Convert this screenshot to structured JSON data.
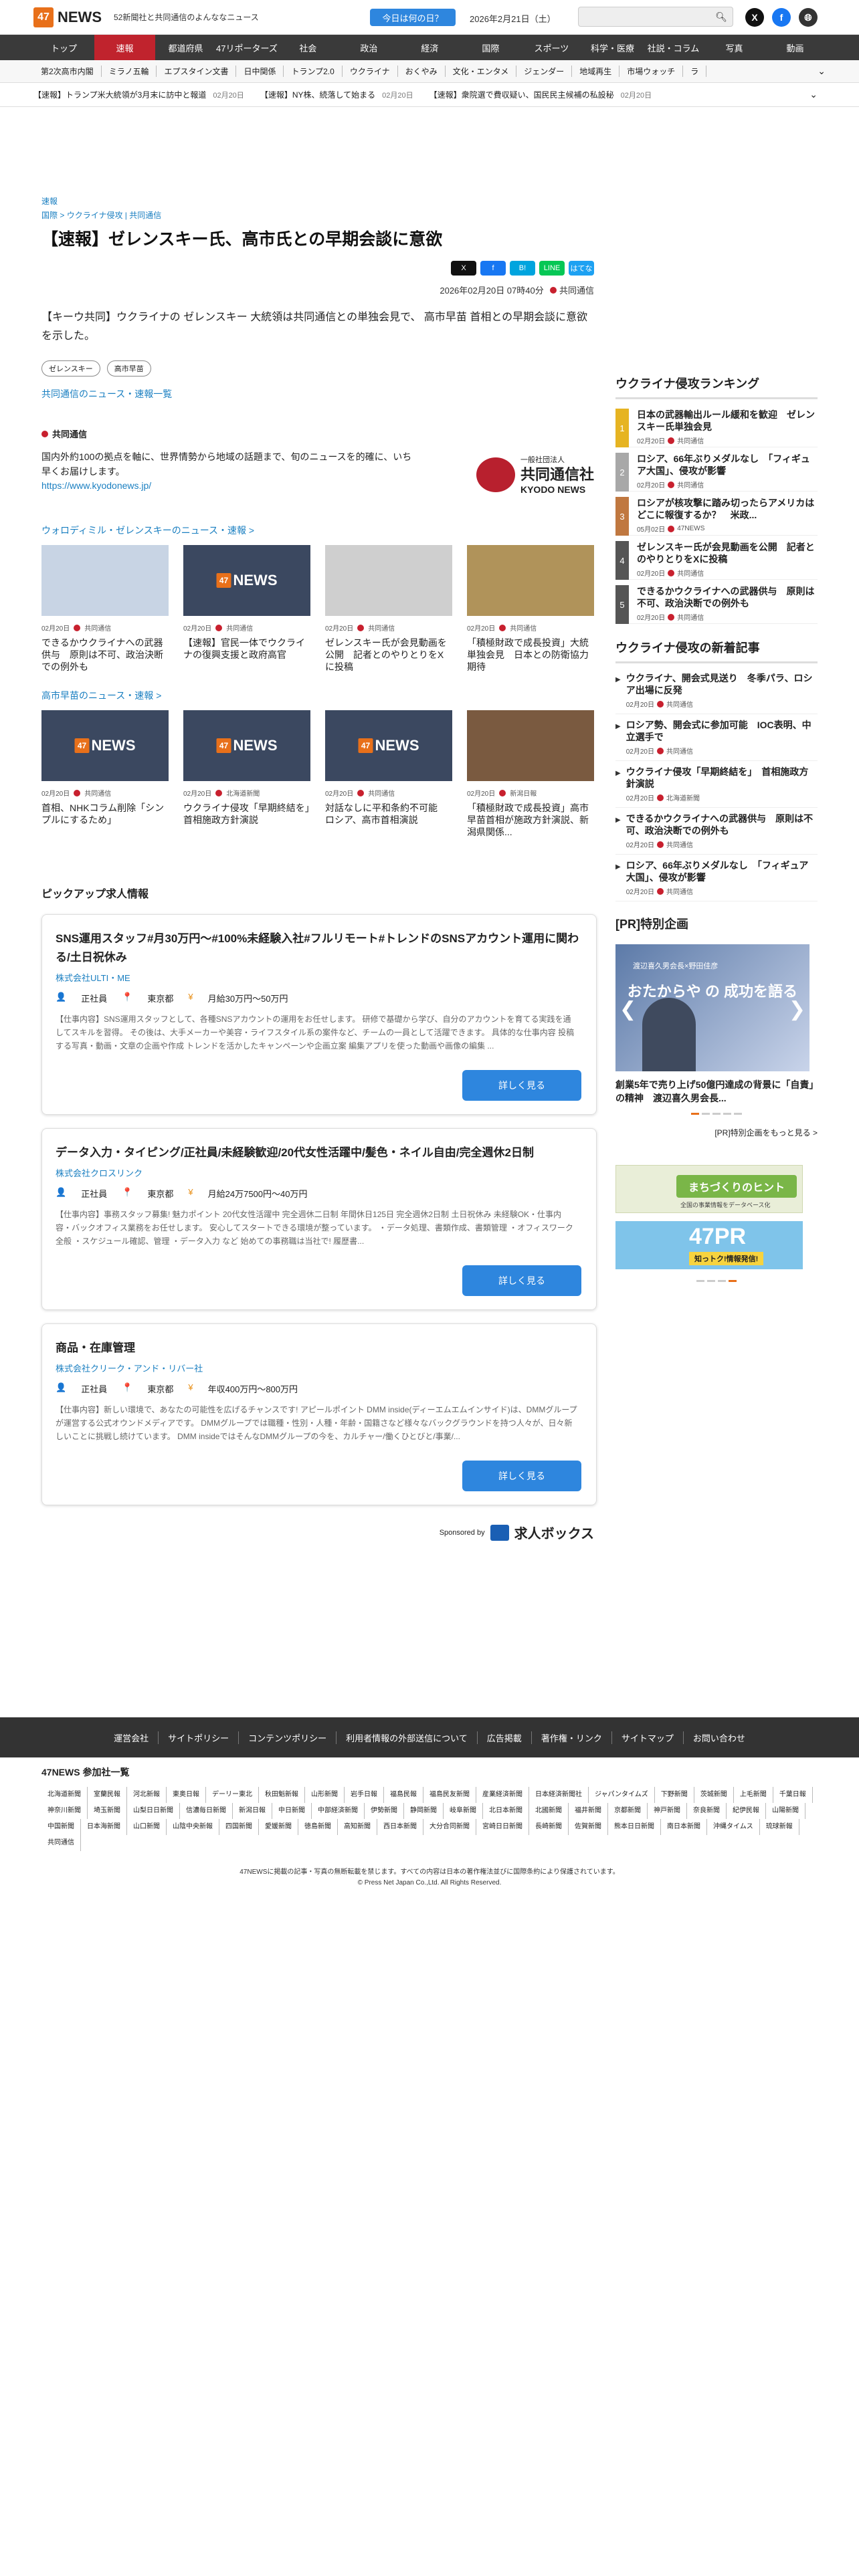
{
  "header": {
    "logo_text": "NEWS",
    "logo_badge": "47",
    "tagline": "52新聞社と共同通信のよんななニュース",
    "today_button": "今日は何の日？",
    "date": "2026年2月21日（土）"
  },
  "nav": [
    "トップ",
    "速報",
    "都道府県",
    "47リポーターズ",
    "社会",
    "政治",
    "経済",
    "国際",
    "スポーツ",
    "科学・医療",
    "社説・コラム",
    "写真",
    "動画"
  ],
  "subnav": [
    "第2次高市内閣",
    "ミラノ五輪",
    "エプスタイン文書",
    "日中関係",
    "トランプ2.0",
    "ウクライナ",
    "おくやみ",
    "文化・エンタメ",
    "ジェンダー",
    "地域再生",
    "市場ウォッチ",
    "ラ"
  ],
  "ticker": [
    {
      "text": "【速報】トランプ米大統領が3月末に訪中と報道",
      "date": "02月20日"
    },
    {
      "text": "【速報】NY株、続落して始まる",
      "date": "02月20日"
    },
    {
      "text": "【速報】衆院選で費収疑い、国民民主候補の私設秘",
      "date": "02月20日"
    }
  ],
  "article": {
    "label": "速報",
    "breadcrumb": [
      "国際",
      "ウクライナ侵攻",
      "共同通信"
    ],
    "title": "【速報】ゼレンスキー氏、高市氏との早期会談に意欲",
    "share": [
      "X",
      "f",
      "B!",
      "LINE",
      "はてな"
    ],
    "datetime": "2026年02月20日 07時40分",
    "source": "共同通信",
    "lead": "【キーウ共同】ウクライナの ゼレンスキー 大統領は共同通信との単独会見で、 高市早苗 首相との早期会談に意欲を示した。",
    "tags": [
      "ゼレンスキー",
      "高市早苗"
    ],
    "more_link": "共同通信のニュース・速報一覧"
  },
  "kyodo": {
    "name": "共同通信",
    "desc": "国内外約100の拠点を軸に、世界情勢から地域の話題まで、旬のニュースを的確に、いち早くお届けします。",
    "url": "https://www.kyodonews.jp/",
    "logo_small": "一般社団法人",
    "logo_main": "共同通信社",
    "logo_en": "KYODO NEWS"
  },
  "related1": {
    "title": "ウォロディミル・ゼレンスキーのニュース・速報 >",
    "items": [
      {
        "date": "02月20日",
        "src": "共同通信",
        "title": "できるかウクライナへの武器供与　原則は不可、政治決断での例外も"
      },
      {
        "date": "02月20日",
        "src": "共同通信",
        "title": "【速報】官民一体でウクライナの復興支援と政府高官"
      },
      {
        "date": "02月20日",
        "src": "共同通信",
        "title": "ゼレンスキー氏が会見動画を公開　記者とのやりとりをXに投稿"
      },
      {
        "date": "02月20日",
        "src": "共同通信",
        "title": "「積極財政で成長投資」大統 単独会見　日本との防衛協力期待"
      }
    ]
  },
  "related2": {
    "title": "高市早苗のニュース・速報 >",
    "items": [
      {
        "date": "02月20日",
        "src": "共同通信",
        "title": "首相、NHKコラム削除「シンプルにするため」"
      },
      {
        "date": "02月20日",
        "src": "北海道新聞",
        "title": "ウクライナ侵攻「早期終結を」　首相施政方針演説"
      },
      {
        "date": "02月20日",
        "src": "共同通信",
        "title": "対話なしに平和条約不可能　ロシア、高市首相演説"
      },
      {
        "date": "02月20日",
        "src": "新潟日報",
        "title": "「積極財政で成長投資」高市早苗首相が施政方針演説、新潟県関係..."
      }
    ]
  },
  "jobs": {
    "title": "ピックアップ求人情報",
    "detail_button": "詳しく見る",
    "items": [
      {
        "title": "SNS運用スタッフ#月30万円〜#100%未経験入社#フルリモート#トレンドのSNSアカウント運用に関わる/土日祝休み",
        "company": "株式会社ULTI・ME",
        "type": "正社員",
        "place": "東京都",
        "salary": "月給30万円〜50万円",
        "body": "【仕事内容】SNS運用スタッフとして、各種SNSアカウントの運用をお任せします。 研修で基礎から学び、自分のアカウントを育てる実践を通してスキルを習得。 その後は、大手メーカーや美容・ライフスタイル系の案件など、チームの一員として活躍できます。 具体的な仕事内容 投稿する写真・動画・文章の企画や作成 トレンドを活かしたキャンペーンや企画立案 編集アプリを使った動画や画像の編集 ..."
      },
      {
        "title": "データ入力・タイピング/正社員/未経験歓迎/20代女性活躍中/髪色・ネイル自由/完全週休2日制",
        "company": "株式会社クロスリンク",
        "type": "正社員",
        "place": "東京都",
        "salary": "月給24万7500円〜40万円",
        "body": "【仕事内容】事務スタッフ募集! 魅力ポイント 20代女性活躍中 完全週休二日制 年間休日125日 完全週休2日制 土日祝休み 未経験OK・仕事内容・バックオフィス業務をお任せします。 安心してスタートできる環境が整っています。 ・データ処理、書類作成、書類管理 ・オフィスワーク全般 ・スケジュール確認、管理 ・データ入力 など 始めての事務職は当社で! 履歴書..."
      },
      {
        "title": "商品・在庫管理",
        "company": "株式会社クリーク・アンド・リバー社",
        "type": "正社員",
        "place": "東京都",
        "salary": "年収400万円〜800万円",
        "body": "【仕事内容】新しい環境で、あなたの可能性を広げるチャンスです! アピールポイント DMM inside(ディーエムエムインサイド)は、DMMグループが運営する公式オウンドメディアです。 DMMグループでは職種・性別・人種・年齢・国籍さなど様々なバックグラウンドを持つ人々が、日々新しいことに挑戦し続けています。 DMM insideではそんなDMMグループの今を、カルチャー/働くひとびと/事業/..."
      }
    ],
    "sponsored_by": "Sponsored by",
    "sponsor": "求人ボックス"
  },
  "ranking": {
    "title": "ウクライナ侵攻ランキング",
    "items": [
      {
        "num": "1",
        "title": "日本の武器輸出ルール緩和を歓迎　ゼレンスキー氏単独会見",
        "date": "02月20日",
        "src": "共同通信"
      },
      {
        "num": "2",
        "title": "ロシア、66年ぶりメダルなし　「フィギュア大国」、侵攻が影響",
        "date": "02月20日",
        "src": "共同通信"
      },
      {
        "num": "3",
        "title": "ロシアが核攻撃に踏み切ったらアメリカはどこに報復するか？　米政...",
        "date": "05月02日",
        "src": "47NEWS"
      },
      {
        "num": "4",
        "title": "ゼレンスキー氏が会見動画を公開　記者とのやりとりをXに投稿",
        "date": "02月20日",
        "src": "共同通信"
      },
      {
        "num": "5",
        "title": "できるかウクライナへの武器供与　原則は不可、政治決断での例外も",
        "date": "02月20日",
        "src": "共同通信"
      }
    ],
    "colors": [
      "#e6b422",
      "#a8a8a8",
      "#c07840",
      "#555555",
      "#555555"
    ]
  },
  "newarticles": {
    "title": "ウクライナ侵攻の新着記事",
    "items": [
      {
        "title": "ウクライナ、開会式見送り　冬季パラ、ロシア出場に反発",
        "date": "02月20日",
        "src": "共同通信"
      },
      {
        "title": "ロシア勢、開会式に参加可能　IOC表明、中立選手で",
        "date": "02月20日",
        "src": "共同通信"
      },
      {
        "title": "ウクライナ侵攻「早期終結を」　首相施政方針演説",
        "date": "02月20日",
        "src": "北海道新聞"
      },
      {
        "title": "できるかウクライナへの武器供与　原則は不可、政治決断での例外も",
        "date": "02月20日",
        "src": "共同通信"
      },
      {
        "title": "ロシア、66年ぶりメダルなし　「フィギュア大国」、侵攻が影響",
        "date": "02月20日",
        "src": "共同通信"
      }
    ]
  },
  "pr": {
    "title": "[PR]特別企画",
    "banner_text": "おたからや の 成功を語る",
    "banner_sub": "渡辺喜久男会長×野田佳彦",
    "caption": "創業5年で売り上げ50億円達成の背景に「自責」の精神　渡辺喜久男会長...",
    "more": "[PR]特別企画をもっと見る >",
    "ad1": "まちづくりのヒント",
    "ad1_sub": "全国の事業情報をデータベース化",
    "ad2": "47PR",
    "ad2_sub": "知っトク!情報発信!"
  },
  "footer": {
    "links": [
      "運営会社",
      "サイトポリシー",
      "コンテンツポリシー",
      "利用者情報の外部送信について",
      "広告掲載",
      "著作権・リンク",
      "サイトマップ",
      "お問い合わせ"
    ],
    "members_title": "47NEWS 参加社一覧",
    "members": [
      "北海道新聞",
      "室蘭民報",
      "河北新報",
      "東奥日報",
      "デーリー東北",
      "秋田魁新報",
      "山形新聞",
      "岩手日報",
      "福島民報",
      "福島民友新聞",
      "産業経済新聞",
      "日本経済新聞社",
      "ジャパンタイムズ",
      "下野新聞",
      "茨城新聞",
      "上毛新聞",
      "千葉日報",
      "神奈川新聞",
      "埼玉新聞",
      "山梨日日新聞",
      "信濃毎日新聞",
      "新潟日報",
      "中日新聞",
      "中部経済新聞",
      "伊勢新聞",
      "静岡新聞",
      "岐阜新聞",
      "北日本新聞",
      "北國新聞",
      "福井新聞",
      "京都新聞",
      "神戸新聞",
      "奈良新聞",
      "紀伊民報",
      "山陽新聞",
      "中国新聞",
      "日本海新聞",
      "山口新聞",
      "山陰中央新報",
      "四国新聞",
      "愛媛新聞",
      "徳島新聞",
      "高知新聞",
      "西日本新聞",
      "大分合同新聞",
      "宮崎日日新聞",
      "長崎新聞",
      "佐賀新聞",
      "熊本日日新聞",
      "南日本新聞",
      "沖縄タイムス",
      "琉球新報",
      "共同通信"
    ],
    "copy1": "47NEWSに掲載の記事・写真の無断転載を禁じます。すべての内容は日本の著作権法並びに国際条約により保護されています。",
    "copy2": "© Press Net Japan Co.,Ltd. All Rights Reserved."
  }
}
